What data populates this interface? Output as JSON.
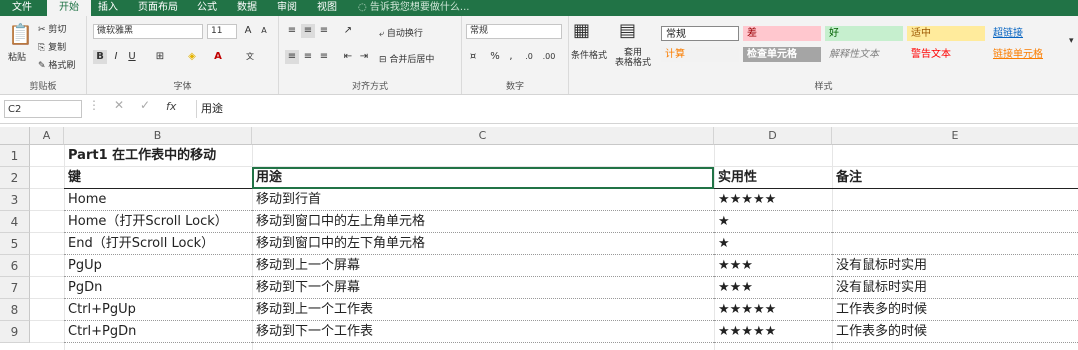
{
  "tabs": [
    "文件",
    "开始",
    "插入",
    "页面布局",
    "公式",
    "数据",
    "审阅",
    "视图"
  ],
  "tell_me": "告诉我您想要做什么...",
  "clipboard": {
    "paste": "粘贴",
    "cut": "剪切",
    "copy": "复制",
    "format_painter": "格式刷",
    "label": "剪贴板"
  },
  "font": {
    "name": "微软雅黑",
    "size": "11",
    "label": "字体",
    "bold": "B",
    "italic": "I",
    "underline": "U"
  },
  "alignment": {
    "wrap": "自动换行",
    "merge": "合并后居中",
    "label": "对齐方式"
  },
  "number": {
    "format": "常规",
    "label": "数字"
  },
  "styles_group": {
    "cond_format": "条件格式",
    "table_format": "套用\n表格格式",
    "label": "样式"
  },
  "styles": [
    {
      "text": "常规",
      "bg": "#ffffff",
      "color": "#222222"
    },
    {
      "text": "差",
      "bg": "#ffc7ce",
      "color": "#9c0006"
    },
    {
      "text": "好",
      "bg": "#c6efce",
      "color": "#006100"
    },
    {
      "text": "适中",
      "bg": "#ffeb9c",
      "color": "#9c5700"
    },
    {
      "text": "超链接",
      "bg": "#f3f3f3",
      "color": "#0563c1"
    },
    {
      "text": "计算",
      "bg": "#f2f2f2",
      "color": "#fa7d00"
    },
    {
      "text": "检查单元格",
      "bg": "#a5a5a5",
      "color": "#ffffff"
    },
    {
      "text": "解释性文本",
      "bg": "#f3f3f3",
      "color": "#7f7f7f"
    },
    {
      "text": "警告文本",
      "bg": "#f3f3f3",
      "color": "#ff0000"
    },
    {
      "text": "链接单元格",
      "bg": "#f3f3f3",
      "color": "#fa7d00"
    }
  ],
  "formula_bar": {
    "cell_ref": "C2",
    "fx": "fx",
    "content": "用途"
  },
  "columns": [
    "A",
    "B",
    "C",
    "D",
    "E"
  ],
  "rows": [
    {
      "num": "1",
      "b": "Part1 在工作表中的移动",
      "c": "",
      "d": "",
      "e": ""
    },
    {
      "num": "2",
      "b": "键",
      "c": "用途",
      "d": "实用性",
      "e": "备注"
    },
    {
      "num": "3",
      "b": "Home",
      "c": "移动到行首",
      "d": "★★★★★",
      "e": ""
    },
    {
      "num": "4",
      "b": "Home（打开Scroll Lock）",
      "c": "移动到窗口中的左上角单元格",
      "d": "★",
      "e": ""
    },
    {
      "num": "5",
      "b": "End（打开Scroll Lock）",
      "c": "移动到窗口中的左下角单元格",
      "d": "★",
      "e": ""
    },
    {
      "num": "6",
      "b": "PgUp",
      "c": "移动到上一个屏幕",
      "d": "★★★",
      "e": "没有鼠标时实用"
    },
    {
      "num": "7",
      "b": "PgDn",
      "c": "移动到下一个屏幕",
      "d": "★★★",
      "e": "没有鼠标时实用"
    },
    {
      "num": "8",
      "b": "Ctrl+PgUp",
      "c": "移动到上一个工作表",
      "d": "★★★★★",
      "e": "工作表多的时候"
    },
    {
      "num": "9",
      "b": "Ctrl+PgDn",
      "c": "移动到下一个工作表",
      "d": "★★★★★",
      "e": "工作表多的时候"
    }
  ]
}
